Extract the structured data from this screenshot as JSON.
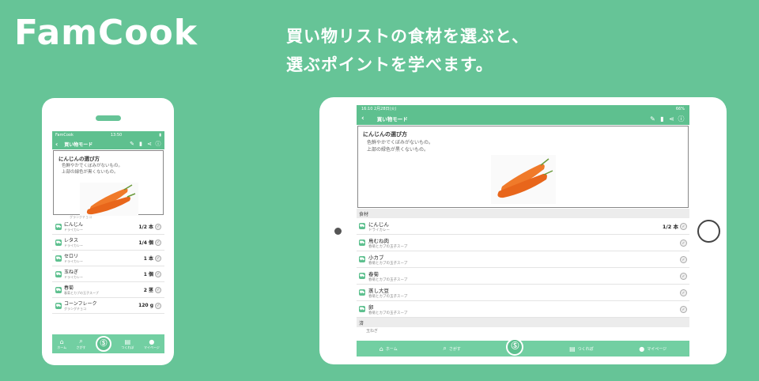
{
  "brand": "FamCook",
  "headline": {
    "line1": "買い物リストの食材を選ぶと、",
    "line2": "選ぶポイントを学べます。"
  },
  "colors": {
    "bg": "#66c497",
    "accent": "#5ec08f"
  },
  "phone": {
    "status": {
      "carrier": "FamCook",
      "time": "13:50"
    },
    "appbar": {
      "back": "‹",
      "title": "買い物モード"
    },
    "info": {
      "title": "にんじんの選び方",
      "line1": "色鮮やかでくぼみがないもの。",
      "line2": "上部の緑色が黒くないもの。"
    },
    "partial_sub": "グラングチョコ",
    "items": [
      {
        "name": "にんじん",
        "sub": "ドライカレー",
        "qty": "1/2 本"
      },
      {
        "name": "レタス",
        "sub": "ドライカレー",
        "qty": "1/4 個"
      },
      {
        "name": "セロリ",
        "sub": "ドライカレー",
        "qty": "1 本"
      },
      {
        "name": "玉ねぎ",
        "sub": "ドライカレー",
        "qty": "1 個"
      },
      {
        "name": "春菊",
        "sub": "春菊とカブの玉子スープ",
        "qty": "2 茎"
      },
      {
        "name": "コーンフレーク",
        "sub": "グラングチョコ",
        "qty": "120 g"
      }
    ],
    "tabs": [
      {
        "icon": "⌂",
        "label": "ホーム"
      },
      {
        "icon": "⌕",
        "label": "さがす"
      },
      {
        "icon": "▤",
        "label": "つくれぽ"
      },
      {
        "icon": "●",
        "label": "マイページ"
      }
    ]
  },
  "tablet": {
    "status": {
      "time": "16:10 2月28日(火)",
      "battery": "66%"
    },
    "appbar": {
      "back": "‹",
      "title": "買い物モード"
    },
    "info": {
      "title": "にんじんの選び方",
      "line1": "色鮮やかでくぼみがないもの。",
      "line2": "上部の緑色が黒くないもの。"
    },
    "section": "食材",
    "section2": "済",
    "items": [
      {
        "name": "にんじん",
        "sub": "ドライカレー",
        "qty": "1/2 本"
      },
      {
        "name": "鳥むね肉",
        "sub": "春菊とカブの玉子スープ",
        "qty": ""
      },
      {
        "name": "小カブ",
        "sub": "春菊とカブの玉子スープ",
        "qty": ""
      },
      {
        "name": "春菊",
        "sub": "春菊とカブの玉子スープ",
        "qty": ""
      },
      {
        "name": "蒸し大豆",
        "sub": "春菊とカブの玉子スープ",
        "qty": ""
      },
      {
        "name": "卵",
        "sub": "春菊とカブの玉子スープ",
        "qty": ""
      }
    ],
    "partial": "玉ねぎ",
    "tabs": [
      {
        "icon": "⌂",
        "label": "ホーム"
      },
      {
        "icon": "⌕",
        "label": "さがす"
      },
      {
        "icon": "▤",
        "label": "つくれぽ"
      },
      {
        "icon": "●",
        "label": "マイページ"
      }
    ]
  }
}
